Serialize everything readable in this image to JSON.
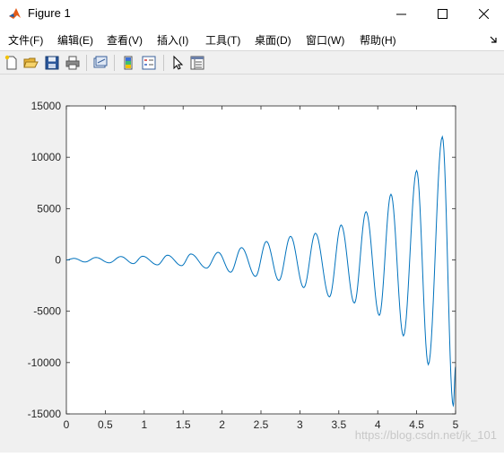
{
  "window": {
    "title": "Figure 1"
  },
  "menu": [
    {
      "label": "文件(F)"
    },
    {
      "label": "编辑(E)"
    },
    {
      "label": "查看(V)"
    },
    {
      "label": "插入(I)"
    },
    {
      "label": "工具(T)"
    },
    {
      "label": "桌面(D)"
    },
    {
      "label": "窗口(W)"
    },
    {
      "label": "帮助(H)"
    }
  ],
  "toolbar": {
    "icons": [
      "new-figure-icon",
      "open-file-icon",
      "save-icon",
      "print-icon",
      "link-plot-icon",
      "insert-colorbar-icon",
      "insert-legend-icon",
      "edit-plot-cursor-icon",
      "property-inspector-icon"
    ]
  },
  "colors": {
    "line": "#0072bd",
    "figure_bg": "#f0f0f0",
    "axes_bg": "#ffffff"
  },
  "chart_data": {
    "type": "line",
    "title": "",
    "xlabel": "",
    "ylabel": "",
    "xlim": [
      0,
      5
    ],
    "ylim": [
      -15000,
      15000
    ],
    "xticks": [
      "0",
      "0.5",
      "1",
      "1.5",
      "2",
      "2.5",
      "3",
      "3.5",
      "4",
      "4.5",
      "5"
    ],
    "yticks": [
      "-15000",
      "-10000",
      "-5000",
      "0",
      "5000",
      "10000",
      "15000"
    ],
    "grid": false,
    "description_of_shape": "oscillating sine with exponentially growing amplitude",
    "series": [
      {
        "values_peaks": [
          [
            0.1,
            150
          ],
          [
            0.38,
            240
          ],
          [
            0.7,
            330
          ],
          [
            0.98,
            360
          ],
          [
            1.3,
            460
          ],
          [
            1.6,
            580
          ],
          [
            1.95,
            740
          ],
          [
            2.25,
            1200
          ],
          [
            2.57,
            1800
          ],
          [
            2.88,
            2300
          ],
          [
            3.2,
            2600
          ],
          [
            3.53,
            3400
          ],
          [
            3.85,
            4700
          ],
          [
            4.17,
            6400
          ],
          [
            4.5,
            8700
          ],
          [
            4.83,
            12000
          ]
        ],
        "values_troughs": [
          [
            0.24,
            -200
          ],
          [
            0.55,
            -280
          ],
          [
            0.86,
            -360
          ],
          [
            1.17,
            -480
          ],
          [
            1.48,
            -560
          ],
          [
            1.8,
            -800
          ],
          [
            2.11,
            -1200
          ],
          [
            2.43,
            -1600
          ],
          [
            2.73,
            -2000
          ],
          [
            3.05,
            -2700
          ],
          [
            3.38,
            -3600
          ],
          [
            3.7,
            -4200
          ],
          [
            4.02,
            -5400
          ],
          [
            4.33,
            -7400
          ],
          [
            4.65,
            -10200
          ],
          [
            4.97,
            -14200
          ]
        ],
        "end_value": [
          5.0,
          -10400
        ]
      }
    ]
  },
  "watermark": "https://blog.csdn.net/jk_101"
}
